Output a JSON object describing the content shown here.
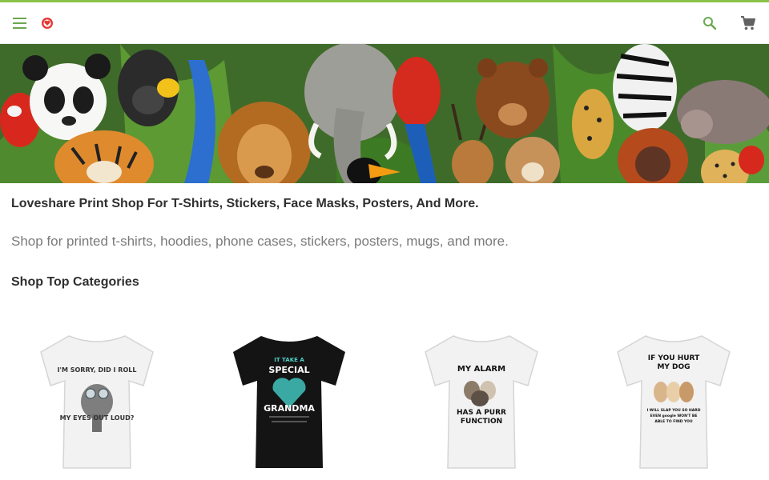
{
  "theme": {
    "accent": "#8bc34a",
    "icon_green": "#6aa84f",
    "cart_gray": "#616161",
    "logo_red": "#e53935"
  },
  "header": {
    "menu_icon": "hamburger-menu-icon",
    "logo_icon": "loveshare-logo-icon",
    "search_icon": "search-icon",
    "cart_icon": "shopping-cart-icon"
  },
  "hero": {
    "image": "jungle animals collage banner (panda, gorilla, parrots, tiger, elephant, lion, toucan, bear, zebra, orangutan, cheetah)"
  },
  "main": {
    "headline": "Loveshare Print Shop For T-Shirts, Stickers, Face Masks, Posters, And More.",
    "subline": "Shop for printed t-shirts, hoodies, phone cases, stickers, posters, mugs, and more.",
    "section_title": "Shop Top Categories"
  },
  "products": [
    {
      "shirt_color": "#f2f2f2",
      "lines": [
        "I'M SORRY, DID I ROLL",
        "MY EYES OUT LOUD?"
      ]
    },
    {
      "shirt_color": "#141414",
      "lines": [
        "IT TAKE A",
        "SPECIAL",
        "GRANDMA"
      ]
    },
    {
      "shirt_color": "#f2f2f2",
      "lines": [
        "MY ALARM",
        "HAS A PURR",
        "FUNCTION"
      ]
    },
    {
      "shirt_color": "#f2f2f2",
      "lines": [
        "IF YOU HURT",
        "MY DOG",
        "I WILL SLAP YOU SO HARD",
        "EVEN google WON'T BE",
        "ABLE TO FIND YOU"
      ]
    }
  ]
}
